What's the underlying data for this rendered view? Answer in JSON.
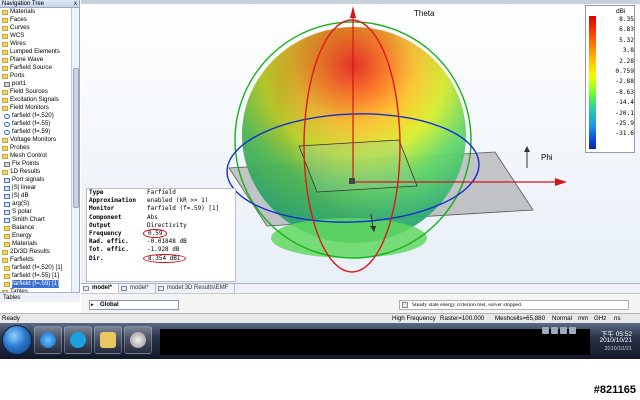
{
  "nav_tree": {
    "title": "Navigation Tree",
    "close": "x",
    "items": [
      {
        "label": "Materials",
        "icon": "folder",
        "level": 1,
        "selected": false
      },
      {
        "label": "Faces",
        "icon": "folder",
        "level": 1,
        "selected": false
      },
      {
        "label": "Curves",
        "icon": "folder",
        "level": 1,
        "selected": false
      },
      {
        "label": "WCS",
        "icon": "folder",
        "level": 1,
        "selected": false
      },
      {
        "label": "Wires",
        "icon": "folder",
        "level": 1,
        "selected": false
      },
      {
        "label": "Lumped Elements",
        "icon": "folder",
        "level": 1,
        "selected": false
      },
      {
        "label": "Plane Wave",
        "icon": "folder",
        "level": 1,
        "selected": false
      },
      {
        "label": "Farfield Source",
        "icon": "folder",
        "level": 1,
        "selected": false
      },
      {
        "label": "Ports",
        "icon": "folder",
        "level": 1,
        "selected": false
      },
      {
        "label": "port1",
        "icon": "port",
        "level": 2,
        "selected": false
      },
      {
        "label": "Field Sources",
        "icon": "folder",
        "level": 1,
        "selected": false
      },
      {
        "label": "Excitation Signals",
        "icon": "folder",
        "level": 1,
        "selected": false
      },
      {
        "label": "Field Monitors",
        "icon": "folder",
        "level": 1,
        "selected": false
      },
      {
        "label": "farfield (f=.520)",
        "icon": "monitor",
        "level": 2,
        "selected": false
      },
      {
        "label": "farfield (f=.55)",
        "icon": "monitor",
        "level": 2,
        "selected": false
      },
      {
        "label": "farfield (f=.59)",
        "icon": "monitor",
        "level": 2,
        "selected": false
      },
      {
        "label": "Voltage Monitors",
        "icon": "folder",
        "level": 1,
        "selected": false
      },
      {
        "label": "Probes",
        "icon": "folder",
        "level": 1,
        "selected": false
      },
      {
        "label": "Mesh Control",
        "icon": "folder",
        "level": 1,
        "selected": false
      },
      {
        "label": "Fix Points",
        "icon": "port",
        "level": 2,
        "selected": false
      },
      {
        "label": "1D Results",
        "icon": "folder",
        "level": 1,
        "selected": false
      },
      {
        "label": "Port signals",
        "icon": "plot",
        "level": 2,
        "selected": false
      },
      {
        "label": "|S| linear",
        "icon": "plot",
        "level": 2,
        "selected": false
      },
      {
        "label": "|S| dB",
        "icon": "plot",
        "level": 2,
        "selected": false
      },
      {
        "label": "arg(S)",
        "icon": "plot",
        "level": 2,
        "selected": false
      },
      {
        "label": "S polar",
        "icon": "plot",
        "level": 2,
        "selected": false
      },
      {
        "label": "Smith Chart",
        "icon": "plot",
        "level": 2,
        "selected": false
      },
      {
        "label": "Balance",
        "icon": "folder",
        "level": 2,
        "selected": false
      },
      {
        "label": "Energy",
        "icon": "folder",
        "level": 2,
        "selected": false
      },
      {
        "label": "Materials",
        "icon": "folder",
        "level": 2,
        "selected": false
      },
      {
        "label": "2D/3D Results",
        "icon": "folder",
        "level": 1,
        "selected": false
      },
      {
        "label": "Farfields",
        "icon": "folder",
        "level": 1,
        "selected": false
      },
      {
        "label": "farfield (f=.520) [1]",
        "icon": "folder",
        "level": 2,
        "selected": false
      },
      {
        "label": "farfield (f=.55) [1]",
        "icon": "folder",
        "level": 2,
        "selected": false
      },
      {
        "label": "farfield (f=.59) [1]",
        "icon": "folder",
        "level": 2,
        "selected": true
      },
      {
        "label": "Tables",
        "icon": "folder",
        "level": 1,
        "selected": false
      }
    ]
  },
  "axes": {
    "theta": "Theta",
    "phi": "Phi"
  },
  "legend": {
    "unit": "dBi",
    "ticks": [
      "8.35",
      "6.83",
      "5.32",
      "3.8",
      "2.28",
      "0.759",
      "-2.88",
      "-8.63",
      "-14.4",
      "-20.1",
      "-25.9",
      "-31.6"
    ]
  },
  "properties": [
    {
      "key": "Type",
      "value": "Farfield",
      "circled": false
    },
    {
      "key": "Approximation",
      "value": "enabled (kR >> 1)",
      "circled": false
    },
    {
      "key": "Monitor",
      "value": "farfield (f=.59) [1]",
      "circled": false
    },
    {
      "key": "Component",
      "value": "Abs",
      "circled": false
    },
    {
      "key": "Output",
      "value": "Directivity",
      "circled": false
    },
    {
      "key": "Frequency",
      "value": "0.59",
      "circled": true
    },
    {
      "key": "Rad. effic.",
      "value": "-0.01848 dB",
      "circled": false
    },
    {
      "key": "Tot. effic.",
      "value": "-1.928 dB",
      "circled": false
    },
    {
      "key": "Dir.",
      "value": "8.354 dBi",
      "circled": true
    }
  ],
  "doc_tabs": [
    {
      "label": "model*",
      "active": true
    },
    {
      "label": "model*",
      "active": false
    },
    {
      "label": "model:3D Results\\EMF",
      "active": false
    }
  ],
  "nav_tabs": {
    "label": "Tables"
  },
  "message_bar": {
    "combo": "Global",
    "message": "Steady state energy criterion met, solver stopped."
  },
  "status_bar": {
    "ready": "Ready",
    "mode": "High Frequency",
    "raster": "Raster=100.000",
    "meshcells": "Meshcells=65,880",
    "normal": "Normal",
    "units": "mm",
    "ghz": "GHz",
    "ns": "ns"
  },
  "taskbar": {
    "time": "下午 05:52",
    "date": "2010/10/21",
    "date2": "2010/10/21"
  },
  "watermark": "#821165",
  "colors": {
    "accent_red": "#e00000",
    "theta_axis": "#d01818",
    "phi_axis": "#d01818",
    "ring_green": "#18b018",
    "ring_blue": "#1030d0",
    "ring_red": "#e01818"
  }
}
